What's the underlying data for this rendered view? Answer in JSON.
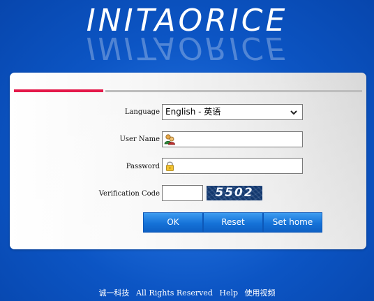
{
  "brand": {
    "name": "INITAORICE"
  },
  "form": {
    "language_label": "Language",
    "language_value": "English - 英语",
    "username_label": "User Name",
    "username_value": "",
    "password_label": "Password",
    "password_value": "",
    "verification_label": "Verification Code",
    "verification_value": "",
    "captcha_text": "5502"
  },
  "buttons": {
    "ok": "OK",
    "reset": "Reset",
    "sethome": "Set home"
  },
  "footer": {
    "company": "诚一科技",
    "rights": "All Rights Reserved",
    "help": "Help",
    "video": "使用视频"
  },
  "colors": {
    "background": "#0a57c8",
    "accent_bar": "#e4194a",
    "button": "#1572d8"
  },
  "icons": {
    "user_field": "user-icon",
    "password_field": "lock-icon",
    "language_dropdown": "chevron-down-icon"
  }
}
